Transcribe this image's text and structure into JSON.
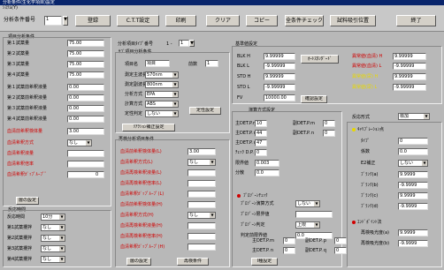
{
  "window": {
    "title": "分析条件(生化学項目)設定",
    "menu": "ｼｽﾃﾑ(Y)"
  },
  "toolbar": {
    "analysis_no_label": "分析条件番号",
    "analysis_no_value": "1",
    "buttons": [
      "登録",
      "C.T.T設定",
      "印刷",
      "クリア",
      "コピー",
      "全条件チェック",
      "試料吸引位置",
      "終了"
    ]
  },
  "item_conditions": {
    "title": "項目分析条件",
    "rows": [
      {
        "label": "第１試薬量",
        "value": "75.00"
      },
      {
        "label": "第２試薬量",
        "value": "75.00"
      },
      {
        "label": "第３試薬量",
        "value": "75.00"
      },
      {
        "label": "第４試薬量",
        "value": "75.00"
      },
      {
        "label": "第１試薬前希釈液量",
        "value": "0.00"
      },
      {
        "label": "第２試薬前希釈液量",
        "value": "0.00"
      },
      {
        "label": "第３試薬前希釈液量",
        "value": "0.00"
      },
      {
        "label": "第４試薬前希釈液量",
        "value": "0.00"
      },
      {
        "label": "血清前希釈検体量",
        "value": "3.00",
        "red": true
      },
      {
        "label": "血清希釈方式",
        "value": "なし",
        "red": true,
        "select": true
      },
      {
        "label": "血清希釈液量",
        "value": "",
        "red": true
      },
      {
        "label": "血清希釈倍率",
        "value": "",
        "red": true
      },
      {
        "label": "血清希釈ｶﾞｯﾌﾟﾙｰﾌﾟﾟ",
        "value": "",
        "red": true,
        "extra": "0"
      }
    ],
    "layer_button": "層の設定"
  },
  "reaction_time": {
    "title": "反応時間",
    "rows": [
      {
        "label": "反応時間",
        "value": "10分",
        "select": true
      },
      {
        "label": "第1試薬攪拌",
        "value": "なし",
        "select": true
      },
      {
        "label": "第2試薬攪拌",
        "value": "なし",
        "select": true
      },
      {
        "label": "第3試薬攪拌",
        "value": "なし",
        "select": true
      },
      {
        "label": "第4試薬攪拌",
        "value": "なし",
        "select": true
      }
    ]
  },
  "analysis_type": {
    "header_label": "分析項目ﾀｲﾌﾟ番号",
    "header_prefix": "1 -",
    "header_value": "1",
    "sub_title": "ｻﾌﾞ項目分析条件",
    "item_name_label": "項目名",
    "item_name_value": "項目",
    "prefix_label": "前数",
    "prefix_value": "1",
    "rows": [
      {
        "label": "測定主波長",
        "value": "570nm"
      },
      {
        "label": "測定副波長",
        "value": "800nm"
      },
      {
        "label": "分析方式",
        "value": "EPA"
      },
      {
        "label": "計算方式",
        "value": "ABS"
      },
      {
        "label": "定性判定",
        "value": "しない"
      }
    ],
    "qual_button": "定性設定",
    "reagent_button": "ﾘｱｸｼｮﾝ補正設定"
  },
  "rerun": {
    "title": "再検分析項目条件",
    "rows": [
      {
        "label": "血清前希釈検体量(L)",
        "value": "3.00"
      },
      {
        "label": "血清希釈方式(L)",
        "value": "なし",
        "select": true
      },
      {
        "label": "血清再検希釈液量(L)",
        "value": ""
      },
      {
        "label": "血清再検希釈倍率(L)",
        "value": ""
      },
      {
        "label": "血清希釈ｶﾞｯﾌﾟﾙｰﾌﾟ(L)",
        "value": ""
      },
      {
        "label": "血清前希釈検体量(H)",
        "value": ""
      },
      {
        "label": "血清希釈方式(H)",
        "value": "なし",
        "select": true
      },
      {
        "label": "血清再検希釈液量(H)",
        "value": ""
      },
      {
        "label": "血清再検希釈倍率(H)",
        "value": ""
      },
      {
        "label": "血清希釈ｶﾞｯﾌﾟﾙｰﾌﾟ(H)",
        "value": ""
      }
    ],
    "layer_button": "層の設定",
    "rerun_button": "再検条件"
  },
  "reference": {
    "title": "基準値設定",
    "rows": [
      {
        "label": "BLK H",
        "value": "9.99999"
      },
      {
        "label": "BLK L",
        "value": "-9.99999"
      },
      {
        "label": "STD H",
        "value": "9.99999"
      },
      {
        "label": "STD L",
        "value": "-9.99999"
      },
      {
        "label": "FV",
        "value": "10000.00"
      }
    ],
    "auto_button": "ｵｰﾄｽﾀﾝﾀﾞｰﾄﾞ",
    "check_button": "確認設定",
    "abnormal": [
      {
        "label": "異常値(血清) H",
        "value": "9.99999"
      },
      {
        "label": "異常値(血清) L",
        "value": "-9.99999"
      },
      {
        "label": "異常値(尿) H",
        "value": "9.99999"
      },
      {
        "label": "異常値(尿) L",
        "value": "-9.99999"
      }
    ]
  },
  "calc": {
    "title": "演算方式設定",
    "rows": [
      {
        "label": "主DET.P.ｍ",
        "value": "10",
        "label2": "副DET.P.ｍ",
        "value2": "0"
      },
      {
        "label": "主DET.P.ｎ",
        "value": "44",
        "label2": "副DET.P.ｎ",
        "value2": "0"
      },
      {
        "label": "主DET.P.ｒ",
        "value": "47"
      },
      {
        "label": "ﾁｪｯｸ D.P.",
        "value": "0"
      },
      {
        "label": "限界値",
        "value": "0.003"
      },
      {
        "label": "分散",
        "value": "0.0"
      }
    ],
    "prozone_title": "ﾌﾟﾛｿﾞｰﾝﾁｪｯｸ",
    "prozone_rows": [
      {
        "label": "ﾌﾟﾛｿﾞｰﾝ演算方式",
        "value": "しない",
        "select": true
      },
      {
        "label": "ﾌﾟﾛｿﾞｰﾝ限界値",
        "value": ""
      },
      {
        "label": "ﾌﾟﾛｿﾞｰﾝ判定",
        "value": "上限",
        "select": true
      },
      {
        "label": "判定前限界値",
        "value": "0.0"
      }
    ],
    "det_bottom": [
      {
        "label": "主DET.P.ｍ",
        "value": "0",
        "label2": "副DET.P.ｐ",
        "value2": "0"
      },
      {
        "label": "主DET.P.ｎ",
        "value": "0",
        "label2": "副DET.P.ｑ",
        "value2": "0"
      }
    ],
    "line_button": "I種設定"
  },
  "reaction": {
    "title": "反応形式",
    "type_value": "標加",
    "calib_title": "ｷｬﾘﾌﾞﾚｰｼｮﾝ点",
    "rows": [
      {
        "label": "ﾀｲﾌﾟ",
        "value": "0"
      },
      {
        "label": "係数",
        "value": "0.0"
      },
      {
        "label": "E2補正",
        "value": "しない",
        "select": true
      },
      {
        "label": "ﾌﾞﾗﾝｸ(a)",
        "value": "9.9999"
      },
      {
        "label": "ﾌﾞﾗﾝｸ(b)",
        "value": "-9.9999"
      },
      {
        "label": "ﾌﾞﾗﾝｸ(c)",
        "value": "9.9999"
      },
      {
        "label": "ﾌﾞﾗﾝｸ(d)",
        "value": "-9.9999"
      }
    ],
    "endpoint_title": "ｴﾝﾄﾞﾎﾟｲﾝﾄ法",
    "endpoint_rows": [
      {
        "label": "再検吸光度(a)",
        "value": "9.9999"
      },
      {
        "label": "再検吸光度(b)",
        "value": "-9.9999"
      }
    ]
  }
}
